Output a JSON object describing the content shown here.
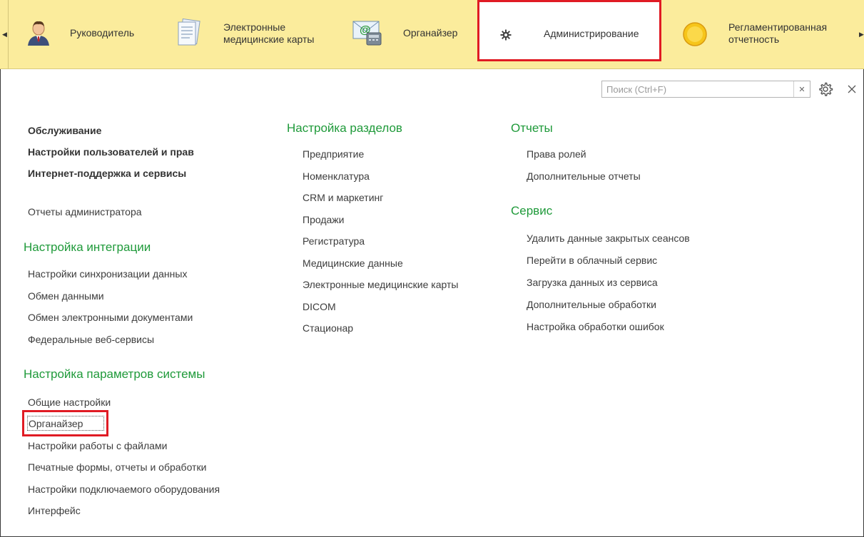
{
  "sections": [
    {
      "label": "Руководитель",
      "icon": "manager-icon"
    },
    {
      "label": "Электронные медицинские карты",
      "icon": "medical-cards-icon"
    },
    {
      "label": "Органайзер",
      "icon": "organizer-icon"
    },
    {
      "label": "Администрирование",
      "icon": "gear-icon",
      "active": true
    },
    {
      "label": "Регламентированная отчетность",
      "icon": "regulated-reporting-icon"
    }
  ],
  "search": {
    "placeholder": "Поиск (Ctrl+F)",
    "value": ""
  },
  "column1": {
    "bold_items": [
      "Обслуживание",
      "Настройки пользователей и прав",
      "Интернет-поддержка и сервисы"
    ],
    "admin_reports": "Отчеты администратора",
    "integration": {
      "title": "Настройка интеграции",
      "items": [
        "Настройки синхронизации данных",
        "Обмен данными",
        "Обмен электронными документами",
        "Федеральные веб-сервисы"
      ]
    },
    "system_params": {
      "title": "Настройка параметров системы",
      "items": [
        "Общие настройки",
        "Органайзер",
        "Настройки работы с файлами",
        "Печатные формы, отчеты и обработки",
        "Настройки подключаемого оборудования",
        "Интерфейс"
      ]
    }
  },
  "column2": {
    "title": "Настройка разделов",
    "items": [
      "Предприятие",
      "Номенклатура",
      "CRM и маркетинг",
      "Продажи",
      "Регистратура",
      "Медицинские данные",
      "Электронные медицинские карты",
      "DICOM",
      "Стационар"
    ]
  },
  "column3": {
    "reports": {
      "title": "Отчеты",
      "items": [
        "Права ролей",
        "Дополнительные отчеты"
      ]
    },
    "service": {
      "title": "Сервис",
      "items": [
        "Удалить данные закрытых сеансов",
        "Перейти в облачный сервис",
        "Загрузка данных из сервиса",
        "Дополнительные обработки",
        "Настройка обработки ошибок"
      ]
    }
  },
  "colors": {
    "section_bar": "#fbec9c",
    "heading": "#1f9a3a",
    "highlight": "#e01b24"
  }
}
